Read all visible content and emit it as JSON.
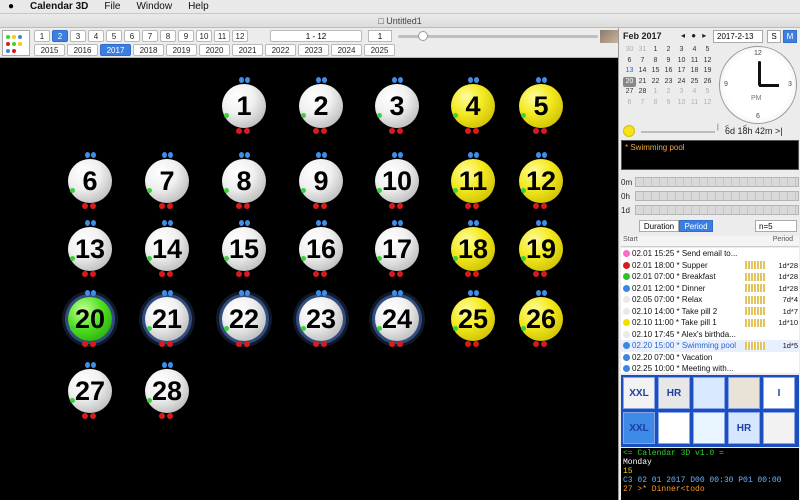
{
  "menubar": {
    "apple": "",
    "app": "Calendar 3D",
    "items": [
      "File",
      "Window",
      "Help"
    ]
  },
  "window": {
    "title": "Untitled1"
  },
  "toolbar": {
    "months": [
      "1",
      "2",
      "3",
      "4",
      "5",
      "6",
      "7",
      "8",
      "9",
      "10",
      "11",
      "12"
    ],
    "selected_month": "2",
    "years": [
      "2015",
      "2016",
      "2017",
      "2018",
      "2019",
      "2020",
      "2021",
      "2022",
      "2023",
      "2024",
      "2025"
    ],
    "selected_year": "2017",
    "range": "1 - 12",
    "current": "1"
  },
  "days": [
    {
      "n": "1",
      "color": "white"
    },
    {
      "n": "2",
      "color": "white"
    },
    {
      "n": "3",
      "color": "white"
    },
    {
      "n": "4",
      "color": "yellow"
    },
    {
      "n": "5",
      "color": "yellow"
    },
    {
      "n": "6",
      "color": "white"
    },
    {
      "n": "7",
      "color": "white"
    },
    {
      "n": "8",
      "color": "white"
    },
    {
      "n": "9",
      "color": "white"
    },
    {
      "n": "10",
      "color": "white"
    },
    {
      "n": "11",
      "color": "yellow"
    },
    {
      "n": "12",
      "color": "yellow"
    },
    {
      "n": "13",
      "color": "white"
    },
    {
      "n": "14",
      "color": "white"
    },
    {
      "n": "15",
      "color": "white"
    },
    {
      "n": "16",
      "color": "white"
    },
    {
      "n": "17",
      "color": "white"
    },
    {
      "n": "18",
      "color": "yellow"
    },
    {
      "n": "19",
      "color": "yellow"
    },
    {
      "n": "20",
      "color": "green"
    },
    {
      "n": "21",
      "color": "white"
    },
    {
      "n": "22",
      "color": "white"
    },
    {
      "n": "23",
      "color": "white"
    },
    {
      "n": "24",
      "color": "white"
    },
    {
      "n": "25",
      "color": "yellow"
    },
    {
      "n": "26",
      "color": "yellow"
    },
    {
      "n": "27",
      "color": "white"
    },
    {
      "n": "28",
      "color": "white"
    }
  ],
  "sidebar": {
    "month_label": "Feb 2017",
    "nav": "◂ ● ▸",
    "date_field": "2017-2-13",
    "view_s": "S",
    "view_m": "M",
    "cal_rows": [
      [
        "30",
        "31",
        "1",
        "2",
        "3",
        "4",
        "5"
      ],
      [
        "6",
        "7",
        "8",
        "9",
        "10",
        "11",
        "12"
      ],
      [
        "13",
        "14",
        "15",
        "16",
        "17",
        "18",
        "19"
      ],
      [
        "20",
        "21",
        "22",
        "23",
        "24",
        "25",
        "26"
      ],
      [
        "27",
        "28",
        "1",
        "2",
        "3",
        "4",
        "5"
      ],
      [
        "6",
        "7",
        "8",
        "9",
        "10",
        "11",
        "12"
      ]
    ],
    "clock_pm": "PM",
    "clock_numbers": [
      "12",
      "3",
      "6",
      "9"
    ],
    "time_nav": "|< <",
    "countdown": "6d 18h 42m >|",
    "note": "* Swimming pool",
    "usage_labels": [
      "0m",
      "0h",
      "1d"
    ],
    "tab_duration": "Duration",
    "tab_period": "Period",
    "n_select": "n=5",
    "list_header_start": "Start",
    "list_header_period": "Period",
    "events": [
      {
        "text": "02.01 15:25 * Send email to...",
        "color": "#ff6ac8",
        "period": "",
        "grid": false
      },
      {
        "text": "02.01 18:00 * Supper",
        "color": "#d81b1b",
        "period": "1d*28",
        "grid": true
      },
      {
        "text": "02.01 07:00 * Breakfast",
        "color": "#2fbf2f",
        "period": "1d*28",
        "grid": true
      },
      {
        "text": "02.01 12:00 * Dinner",
        "color": "#3a86e0",
        "period": "1d*28",
        "grid": true
      },
      {
        "text": "02.05 07:00 * Relax",
        "color": "#e9e9e9",
        "period": "7d*4",
        "grid": true
      },
      {
        "text": "02.10 14:00 * Take pill 2",
        "color": "#e9e9e9",
        "period": "1d*7",
        "grid": true
      },
      {
        "text": "02.10 11:00 * Take pill 1",
        "color": "#f0e000",
        "period": "1d*10",
        "grid": true
      },
      {
        "text": "02.10 17:45 * Alex's birthda...",
        "color": "#e9e9e9",
        "period": "",
        "grid": false
      },
      {
        "text": "02.20 15:00 * Swimming pool",
        "color": "#3a86e0",
        "period": "1d*5",
        "grid": true,
        "selected": true
      },
      {
        "text": "02.20 07:00 * Vacation",
        "color": "#3a86e0",
        "period": "",
        "grid": false
      },
      {
        "text": "02.25 10:00 * Meeting with...",
        "color": "#3a86e0",
        "period": "",
        "grid": false
      }
    ],
    "icon_tiles": [
      {
        "label": "XXL",
        "bg": "#f2f2f2"
      },
      {
        "label": "HR",
        "bg": "#e7e7e7"
      },
      {
        "label": "",
        "bg": "#d8e8ff"
      },
      {
        "label": "",
        "bg": "#e9e2d6"
      },
      {
        "label": "I",
        "bg": "#ffffff"
      },
      {
        "label": "XXL",
        "bg": "#3d8be6"
      },
      {
        "label": "",
        "bg": "#ffffff"
      },
      {
        "label": "",
        "bg": "#eaf6ff"
      },
      {
        "label": "HR",
        "bg": "#d7e6ff"
      },
      {
        "label": "",
        "bg": "#f2f2f2"
      }
    ],
    "terminal": [
      "<= Calendar 3D v1.0 =",
      "Monday",
      "15",
      "C3 02 01 2017 D00 00:30 P01 00:00",
      "27 >* Dinner<todo"
    ]
  }
}
